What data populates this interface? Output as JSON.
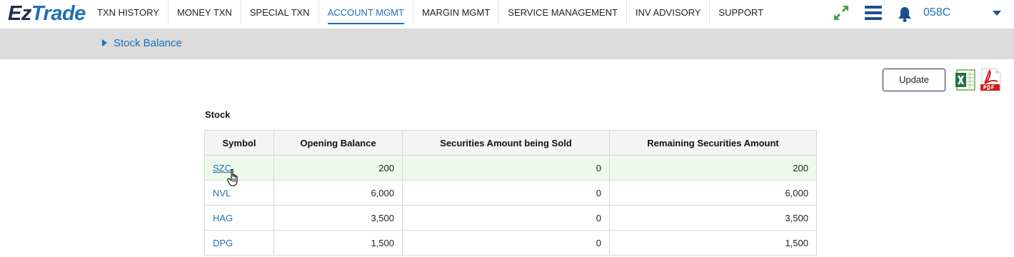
{
  "brand": {
    "part1": "Ez",
    "part2": "Trade"
  },
  "nav": {
    "items": [
      {
        "label": "TXN HISTORY"
      },
      {
        "label": "MONEY TXN"
      },
      {
        "label": "SPECIAL TXN"
      },
      {
        "label": "ACCOUNT MGMT",
        "active": true
      },
      {
        "label": "MARGIN MGMT"
      },
      {
        "label": "SERVICE MANAGEMENT"
      },
      {
        "label": "INV ADVISORY"
      },
      {
        "label": "SUPPORT"
      }
    ]
  },
  "header_icons": [
    "expand-arrows-icon",
    "hamburger-menu-icon",
    "bell-icon",
    "chevron-down-icon"
  ],
  "account": {
    "label": "058C"
  },
  "breadcrumb": {
    "title": "Stock Balance"
  },
  "actions": {
    "update_label": "Update",
    "export_icons": [
      "excel-icon",
      "pdf-icon"
    ]
  },
  "section": {
    "label": "Stock"
  },
  "table": {
    "columns": [
      "Symbol",
      "Opening Balance",
      "Securities Amount being Sold",
      "Remaining Securities Amount"
    ],
    "rows": [
      {
        "symbol": "SZC",
        "opening": "200",
        "sold": "0",
        "remaining": "200"
      },
      {
        "symbol": "NVL",
        "opening": "6,000",
        "sold": "0",
        "remaining": "6,000"
      },
      {
        "symbol": "HAG",
        "opening": "3,500",
        "sold": "0",
        "remaining": "3,500"
      },
      {
        "symbol": "DPG",
        "opening": "1,500",
        "sold": "0",
        "remaining": "1,500"
      }
    ]
  },
  "colors": {
    "brand_dark": "#1b2c4c",
    "brand_blue": "#1f6fb4",
    "breadcrumb_bg": "#dcdcdc",
    "row_highlight": "#edf9ea",
    "expand_icon": "#3aa345"
  }
}
